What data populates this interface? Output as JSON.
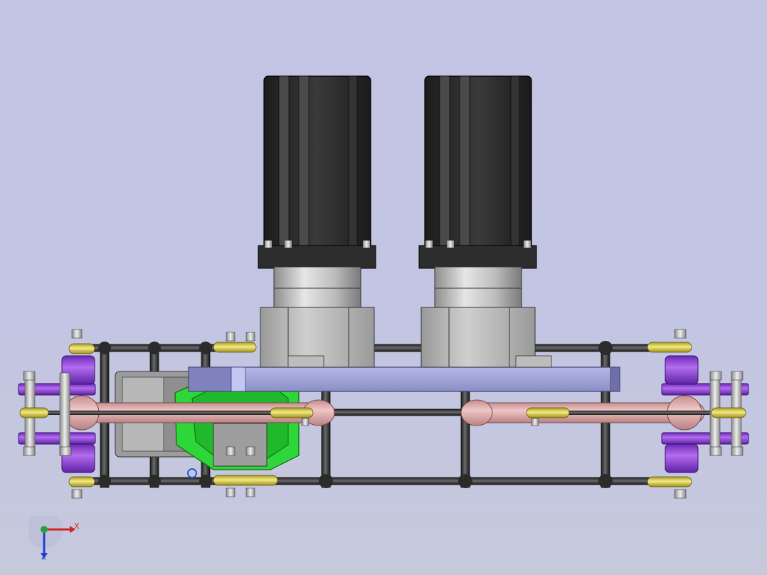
{
  "viewport": {
    "background_top": "#c3c4e3",
    "background_bottom": "#c6c8dc"
  },
  "triad": {
    "x_label": "X",
    "z_label": "Z",
    "x_color": "#d22222",
    "y_color": "#22a33a",
    "z_color": "#1f3fd0"
  },
  "colors": {
    "motor_body": "#2a2a2a",
    "gearbox": "#c8c8c8",
    "housing": "#a9a9a9",
    "plate": "#9ea1d3",
    "rod": "#3b3b3b",
    "tube": "#d9a7a7",
    "clamp": "#8e3fd6",
    "bracket": "#2fd63a",
    "rod_end": "#e2d44c"
  }
}
